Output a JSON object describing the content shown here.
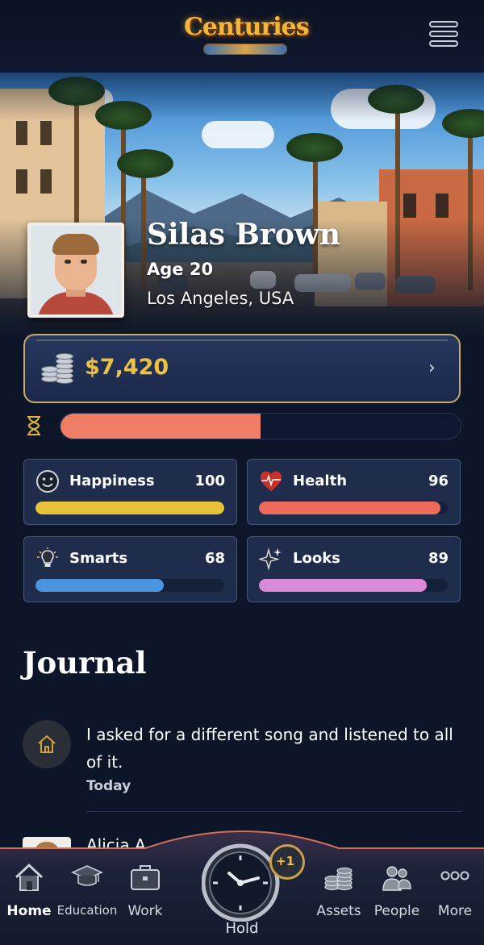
{
  "header": {
    "logo_text": "Centuries",
    "menu_icon": "hamburger-menu-icon"
  },
  "profile": {
    "name": "Silas Brown",
    "age": "Age 20",
    "location": "Los Angeles, USA"
  },
  "money": {
    "value": "$7,420",
    "icon": "coin-stack-icon"
  },
  "time_progress": 0.5,
  "stats": [
    {
      "label": "Happiness",
      "value": "100",
      "level": 1.0,
      "color": "#e8c23a",
      "icon": "smiley-icon"
    },
    {
      "label": "Health",
      "value": "96",
      "level": 0.96,
      "color": "#ee6a5a",
      "icon": "heart-icon"
    },
    {
      "label": "Smarts",
      "value": "68",
      "level": 0.68,
      "color": "#4b95e0",
      "icon": "lightbulb-icon"
    },
    {
      "label": "Looks",
      "value": "89",
      "level": 0.89,
      "color": "#d88ad6",
      "icon": "sparkle-icon"
    }
  ],
  "journal": {
    "title": "Journal",
    "entries": [
      {
        "text": "I asked for a different song and listened to all of it.",
        "date": "Today",
        "icon": "home-icon"
      },
      {
        "text": "Alicia A... ...all and needed",
        "date": ""
      }
    ]
  },
  "nav": {
    "items": [
      {
        "label": "Home",
        "icon": "home-icon",
        "active": true
      },
      {
        "label": "Education",
        "icon": "graduation-cap-icon"
      },
      {
        "label": "Work",
        "icon": "briefcase-icon"
      },
      {
        "label": "Assets",
        "icon": "coin-stack-icon"
      },
      {
        "label": "People",
        "icon": "people-icon"
      },
      {
        "label": "More",
        "icon": "more-dots-icon"
      }
    ],
    "hold_label": "Hold",
    "hold_badge": "+1"
  },
  "colors": {
    "background": "#0d1628",
    "accent_gold": "#f0c040",
    "time_bar": "#f07e66"
  }
}
